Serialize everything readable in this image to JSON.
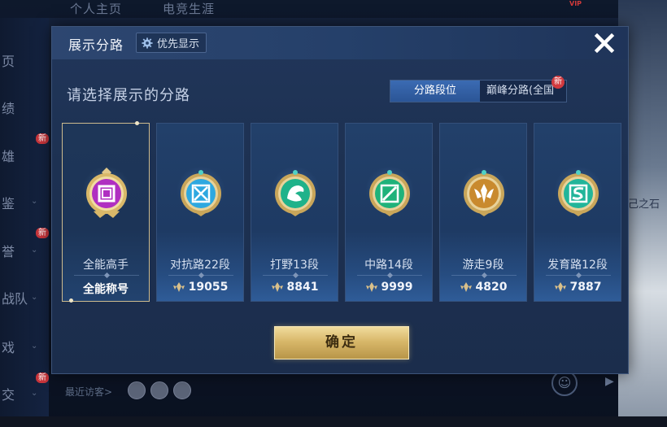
{
  "background": {
    "top_tabs": [
      "个人主页",
      "电竞生涯"
    ],
    "vip_label": "VIP",
    "side_items": [
      "页",
      "绩",
      "雄",
      "鉴",
      "誉",
      "战队",
      "戏",
      "交"
    ],
    "new_badge": "新",
    "recent_visitors_label": "最近访客>",
    "right_text": "己之石"
  },
  "modal": {
    "title": "展示分路",
    "priority_button_label": "优先显示",
    "subtitle": "请选择展示的分路",
    "segments": {
      "active_label": "分路段位",
      "inactive_label": "巅峰分路(全国",
      "new_badge": "新"
    },
    "cards": [
      {
        "name": "全能高手",
        "tag": "全能称号",
        "emblem": "allround-emblem",
        "color": "#b02fc1",
        "selected": true
      },
      {
        "name": "对抗路22段",
        "score": "19055",
        "emblem": "clash-lane-emblem",
        "color": "#2ea8e0",
        "selected": false
      },
      {
        "name": "打野13段",
        "score": "8841",
        "emblem": "jungle-emblem",
        "color": "#1fb28a",
        "selected": false
      },
      {
        "name": "中路14段",
        "score": "9999",
        "emblem": "mid-lane-emblem",
        "color": "#1fb27a",
        "selected": false
      },
      {
        "name": "游走9段",
        "score": "4820",
        "emblem": "roam-emblem",
        "color": "#c98a2e",
        "selected": false
      },
      {
        "name": "发育路12段",
        "score": "7887",
        "emblem": "farm-lane-emblem",
        "color": "#22b59a",
        "selected": false
      }
    ],
    "confirm_label": "确定"
  },
  "colors": {
    "gold_accent": "#d8b86a",
    "active_tab": "#2b5596",
    "modal_bg": "#1d3152"
  }
}
